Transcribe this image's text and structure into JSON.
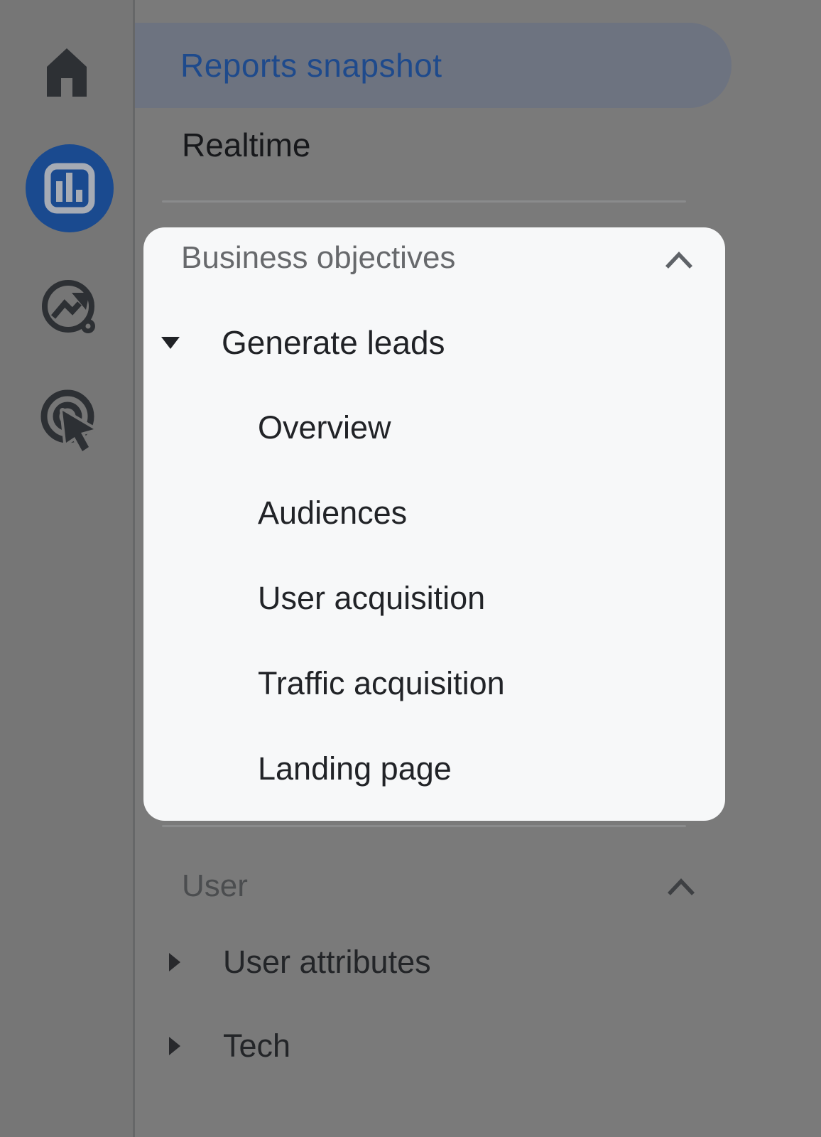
{
  "app": "Google Analytics reports navigation (dimmed walkthrough overlay with spotlight)",
  "colors": {
    "backdrop_dim_gray": "#7a7a7a",
    "rail_gray": "#767676",
    "selected_pill_bg": "#6d7380",
    "selected_pill_text": "#1e4a8c",
    "active_icon_circle_blue": "#1a4a8f",
    "spotlight_panel_bg": "#f7f8f9",
    "panel_header_gray": "#67696c",
    "item_text_dark": "#202226",
    "divider_gray": "#8a8b8c",
    "icon_dark": "#2d3034"
  },
  "rail": {
    "icons": [
      {
        "name": "home-icon"
      },
      {
        "name": "reports-icon",
        "active": true
      },
      {
        "name": "explore-icon"
      },
      {
        "name": "advertising-icon"
      }
    ]
  },
  "sidebar": {
    "top_items": [
      {
        "label": "Reports snapshot",
        "selected": true
      },
      {
        "label": "Realtime",
        "selected": false
      }
    ],
    "spotlight_section": {
      "title": "Business objectives",
      "collapse_chevron": "chevron-up",
      "groups": [
        {
          "label": "Generate leads",
          "expanded": true,
          "children": [
            {
              "label": "Overview"
            },
            {
              "label": "Audiences"
            },
            {
              "label": "User acquisition"
            },
            {
              "label": "Traffic acquisition"
            },
            {
              "label": "Landing page"
            }
          ]
        }
      ]
    },
    "user_section": {
      "title": "User",
      "collapse_chevron": "chevron-up",
      "groups": [
        {
          "label": "User attributes",
          "expanded": false
        },
        {
          "label": "Tech",
          "expanded": false
        }
      ]
    }
  }
}
